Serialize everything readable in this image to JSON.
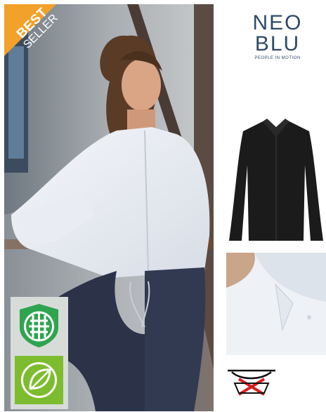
{
  "badge": {
    "line1": "BEST",
    "line2": "SELLER",
    "color": "#f2a12b"
  },
  "brand": {
    "line1": "NEO",
    "line2": "BLU",
    "tagline": "PEOPLE IN MOTION",
    "color": "#2f4a66"
  },
  "icons": {
    "fabric": "fabric-weave-icon",
    "eco": "leaf-icon",
    "care": "no-tumble-dry-icon"
  },
  "colors": {
    "eco_green": "#7cbc2e",
    "fabric_green": "#2fa44f",
    "shirt_black": "#1b1b1b"
  }
}
